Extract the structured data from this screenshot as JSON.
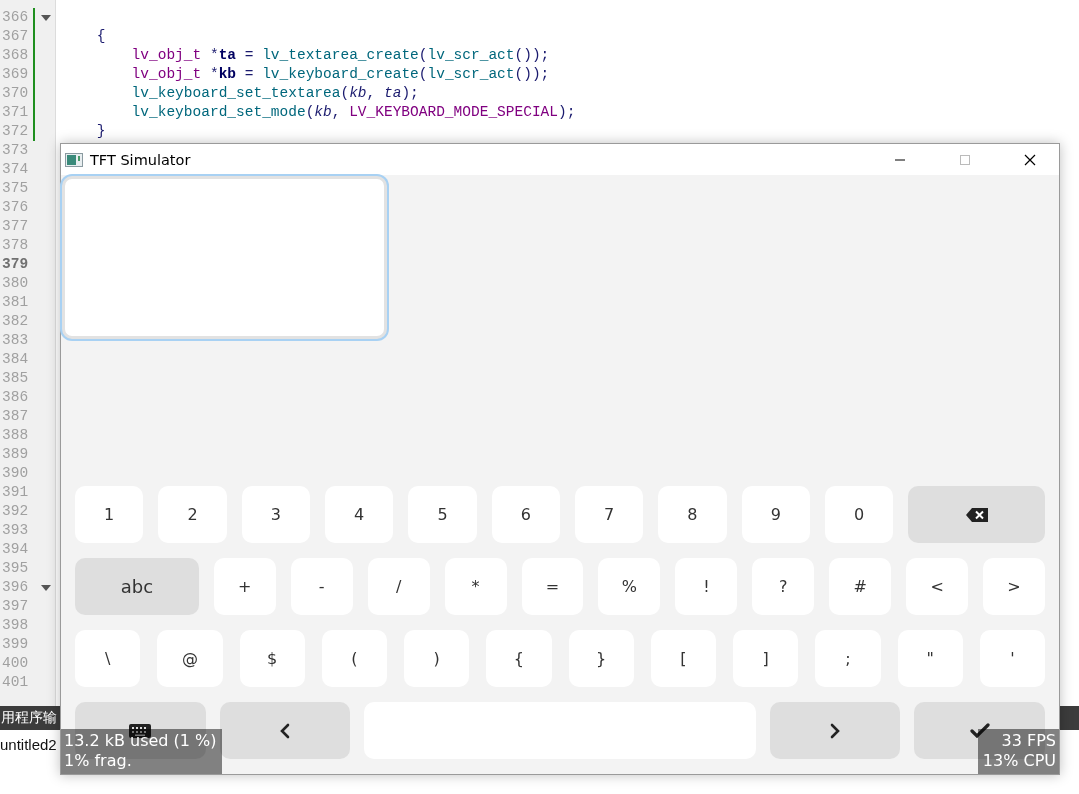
{
  "editor": {
    "code_lines": [
      {
        "number": "366",
        "modified": true,
        "fold_marker": true,
        "current": false
      },
      {
        "number": "367",
        "modified": true,
        "fold_marker": false,
        "current": false,
        "tokens": [
          {
            "text": "    {",
            "kind": "op"
          }
        ]
      },
      {
        "number": "368",
        "modified": true,
        "fold_marker": false,
        "current": false,
        "tokens": [
          {
            "text": "        lv_obj_t",
            "kind": "type"
          },
          {
            "text": " *",
            "kind": "op"
          },
          {
            "text": "ta",
            "kind": "bold"
          },
          {
            "text": " = ",
            "kind": "op"
          },
          {
            "text": "lv_textarea_create",
            "kind": "fn"
          },
          {
            "text": "(",
            "kind": "op"
          },
          {
            "text": "lv_scr_act",
            "kind": "fn"
          },
          {
            "text": "());",
            "kind": "op"
          }
        ]
      },
      {
        "number": "369",
        "modified": true,
        "fold_marker": false,
        "current": false,
        "tokens": [
          {
            "text": "        lv_obj_t",
            "kind": "type"
          },
          {
            "text": " *",
            "kind": "op"
          },
          {
            "text": "kb",
            "kind": "bold"
          },
          {
            "text": " = ",
            "kind": "op"
          },
          {
            "text": "lv_keyboard_create",
            "kind": "fn"
          },
          {
            "text": "(",
            "kind": "op"
          },
          {
            "text": "lv_scr_act",
            "kind": "fn"
          },
          {
            "text": "());",
            "kind": "op"
          }
        ]
      },
      {
        "number": "370",
        "modified": true,
        "fold_marker": false,
        "current": false,
        "tokens": [
          {
            "text": "        lv_keyboard_set_textarea",
            "kind": "fn"
          },
          {
            "text": "(",
            "kind": "op"
          },
          {
            "text": "kb",
            "kind": "param"
          },
          {
            "text": ", ",
            "kind": "op"
          },
          {
            "text": "ta",
            "kind": "param"
          },
          {
            "text": ");",
            "kind": "op"
          }
        ]
      },
      {
        "number": "371",
        "modified": true,
        "fold_marker": false,
        "current": false,
        "tokens": [
          {
            "text": "        lv_keyboard_set_mode",
            "kind": "fn"
          },
          {
            "text": "(",
            "kind": "op"
          },
          {
            "text": "kb",
            "kind": "param"
          },
          {
            "text": ", ",
            "kind": "op"
          },
          {
            "text": "LV_KEYBOARD_MODE_SPECIAL",
            "kind": "macro"
          },
          {
            "text": ");",
            "kind": "op"
          }
        ]
      },
      {
        "number": "372",
        "modified": true,
        "fold_marker": false,
        "current": false,
        "tokens": [
          {
            "text": "    }",
            "kind": "op"
          }
        ]
      },
      {
        "number": "373",
        "modified": false,
        "fold_marker": false,
        "current": false
      },
      {
        "number": "374",
        "modified": false,
        "fold_marker": false,
        "current": false
      },
      {
        "number": "375",
        "modified": false,
        "fold_marker": false,
        "current": false
      },
      {
        "number": "376",
        "modified": false,
        "fold_marker": false,
        "current": false
      },
      {
        "number": "377",
        "modified": false,
        "fold_marker": false,
        "current": false
      },
      {
        "number": "378",
        "modified": false,
        "fold_marker": false,
        "current": false
      },
      {
        "number": "379",
        "modified": false,
        "fold_marker": false,
        "current": true
      },
      {
        "number": "380",
        "modified": false,
        "fold_marker": false,
        "current": false
      },
      {
        "number": "381",
        "modified": false,
        "fold_marker": false,
        "current": false
      },
      {
        "number": "382",
        "modified": false,
        "fold_marker": false,
        "current": false
      },
      {
        "number": "383",
        "modified": false,
        "fold_marker": false,
        "current": false
      },
      {
        "number": "384",
        "modified": false,
        "fold_marker": false,
        "current": false
      },
      {
        "number": "385",
        "modified": false,
        "fold_marker": false,
        "current": false
      },
      {
        "number": "386",
        "modified": false,
        "fold_marker": false,
        "current": false
      },
      {
        "number": "387",
        "modified": false,
        "fold_marker": false,
        "current": false
      },
      {
        "number": "388",
        "modified": false,
        "fold_marker": false,
        "current": false
      },
      {
        "number": "389",
        "modified": false,
        "fold_marker": false,
        "current": false
      },
      {
        "number": "390",
        "modified": false,
        "fold_marker": false,
        "current": false
      },
      {
        "number": "391",
        "modified": false,
        "fold_marker": false,
        "current": false
      },
      {
        "number": "392",
        "modified": false,
        "fold_marker": false,
        "current": false
      },
      {
        "number": "393",
        "modified": false,
        "fold_marker": false,
        "current": false
      },
      {
        "number": "394",
        "modified": false,
        "fold_marker": false,
        "current": false
      },
      {
        "number": "395",
        "modified": false,
        "fold_marker": false,
        "current": false
      },
      {
        "number": "396",
        "modified": false,
        "fold_marker": true,
        "current": false
      },
      {
        "number": "397",
        "modified": false,
        "fold_marker": false,
        "current": false
      },
      {
        "number": "398",
        "modified": false,
        "fold_marker": false,
        "current": false
      },
      {
        "number": "399",
        "modified": false,
        "fold_marker": false,
        "current": false
      },
      {
        "number": "400",
        "modified": false,
        "fold_marker": false,
        "current": false
      },
      {
        "number": "401",
        "modified": false,
        "fold_marker": false,
        "current": false
      }
    ]
  },
  "output_panel": {
    "tab_label": "用程序输",
    "item": "untitled2"
  },
  "simulator": {
    "title": "TFT Simulator",
    "textarea": {
      "focused": true
    },
    "keyboard": {
      "rows": [
        {
          "keys": [
            {
              "label": "1",
              "kind": "char"
            },
            {
              "label": "2",
              "kind": "char"
            },
            {
              "label": "3",
              "kind": "char"
            },
            {
              "label": "4",
              "kind": "char"
            },
            {
              "label": "5",
              "kind": "char"
            },
            {
              "label": "6",
              "kind": "char"
            },
            {
              "label": "7",
              "kind": "char"
            },
            {
              "label": "8",
              "kind": "char"
            },
            {
              "label": "9",
              "kind": "char"
            },
            {
              "label": "0",
              "kind": "char"
            },
            {
              "kind": "backspace"
            }
          ]
        },
        {
          "keys": [
            {
              "label": "abc",
              "kind": "mode"
            },
            {
              "label": "+",
              "kind": "char"
            },
            {
              "label": "-",
              "kind": "char"
            },
            {
              "label": "/",
              "kind": "char"
            },
            {
              "label": "*",
              "kind": "char"
            },
            {
              "label": "=",
              "kind": "char"
            },
            {
              "label": "%",
              "kind": "char"
            },
            {
              "label": "!",
              "kind": "char"
            },
            {
              "label": "?",
              "kind": "char"
            },
            {
              "label": "#",
              "kind": "char"
            },
            {
              "label": "<",
              "kind": "char"
            },
            {
              "label": ">",
              "kind": "char"
            }
          ]
        },
        {
          "keys": [
            {
              "label": "\\",
              "kind": "char"
            },
            {
              "label": "@",
              "kind": "char"
            },
            {
              "label": "$",
              "kind": "char"
            },
            {
              "label": "(",
              "kind": "char"
            },
            {
              "label": ")",
              "kind": "char"
            },
            {
              "label": "{",
              "kind": "char"
            },
            {
              "label": "}",
              "kind": "char"
            },
            {
              "label": "[",
              "kind": "char"
            },
            {
              "label": "]",
              "kind": "char"
            },
            {
              "label": ";",
              "kind": "char"
            },
            {
              "label": "\"",
              "kind": "char"
            },
            {
              "label": "'",
              "kind": "char"
            }
          ]
        },
        {
          "keys": [
            {
              "kind": "keyboard"
            },
            {
              "kind": "left"
            },
            {
              "kind": "space"
            },
            {
              "kind": "right"
            },
            {
              "kind": "ok"
            }
          ]
        }
      ]
    }
  },
  "perf_monitor": {
    "memory_lines": [
      "13.2 kB used (1 %)",
      "1% frag."
    ],
    "fps_lines": [
      "33 FPS",
      "13% CPU"
    ]
  }
}
